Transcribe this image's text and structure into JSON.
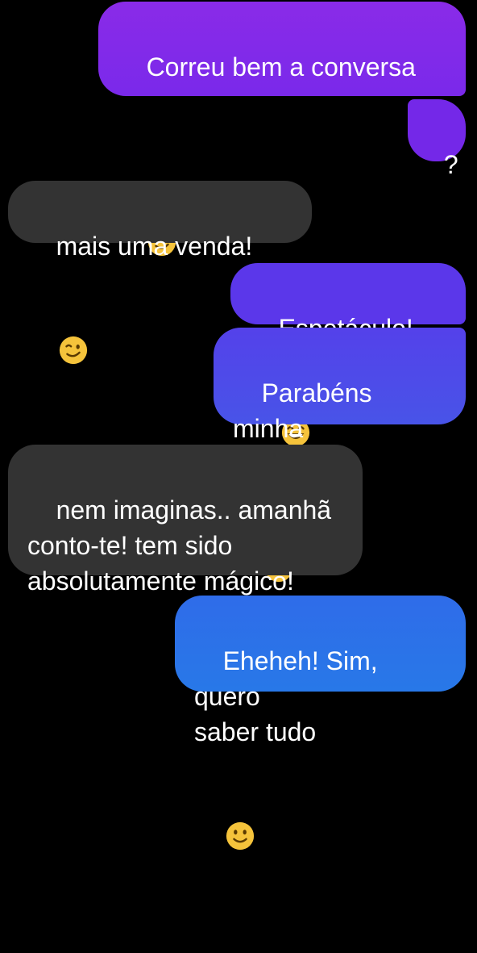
{
  "conversation": {
    "messages": [
      {
        "direction": "sent",
        "text": "Correu bem a conversa",
        "emoji": "winking-face",
        "color": "#7b28ea"
      },
      {
        "direction": "sent",
        "text": "?",
        "emoji": "",
        "color": "#7428e8"
      },
      {
        "direction": "received",
        "text": "mais uma venda!",
        "emoji": "winking-face",
        "color": "#333333"
      },
      {
        "direction": "sent",
        "text": "Espetáculo!",
        "emoji": "grinning-face-with-smiling-eyes",
        "color": "#5b37ea"
      },
      {
        "direction": "sent",
        "text": "Parabéns minha\nquerida!",
        "emoji": "slightly-smiling-face",
        "color": "#4e4ae9"
      },
      {
        "direction": "received",
        "text": "nem imaginas.. amanhã\nconto-te! tem sido\nabsolutamente mágico!",
        "emoji": "",
        "color": "#333333"
      },
      {
        "direction": "sent",
        "text": "Eheheh! Sim, quero\nsaber tudo",
        "emoji": "slightly-smiling-face",
        "color": "#2b72e8"
      }
    ]
  },
  "colors": {
    "background": "#000000",
    "received_bubble": "#333333",
    "text": "#ffffff",
    "emoji_yellow": "#f5c33b"
  }
}
